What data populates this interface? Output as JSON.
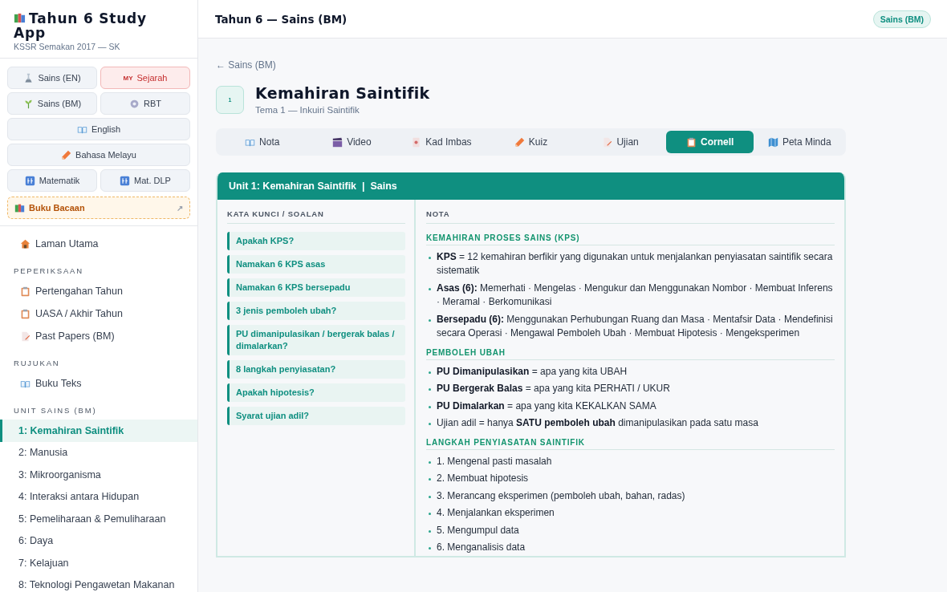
{
  "sidebar": {
    "title": "Tahun 6 Study App",
    "subtitle": "KSSR Semakan 2017 — SK",
    "subjects": [
      {
        "label": "Sains (EN)",
        "kind": "plain",
        "wide": false
      },
      {
        "label": "Sejarah",
        "kind": "featured",
        "wide": false,
        "flag": "MY"
      },
      {
        "label": "Sains (BM)",
        "kind": "plain",
        "wide": false
      },
      {
        "label": "RBT",
        "kind": "plain",
        "wide": false
      },
      {
        "label": "English",
        "kind": "plain",
        "wide": true
      },
      {
        "label": "Bahasa Melayu",
        "kind": "plain",
        "wide": true
      },
      {
        "label": "Matematik",
        "kind": "plain",
        "wide": false
      },
      {
        "label": "Mat. DLP",
        "kind": "plain",
        "wide": false
      },
      {
        "label": "Buku Bacaan",
        "kind": "reading",
        "wide": true,
        "trailing": "↗"
      }
    ],
    "home": {
      "label": "Laman Utama",
      "selected": false
    },
    "sections": [
      {
        "heading": "PEPERIKSAAN",
        "items": [
          {
            "label": "Pertengahan Tahun",
            "selected": false
          },
          {
            "label": "UASA / Akhir Tahun",
            "selected": false
          },
          {
            "label": "Past Papers (BM)",
            "selected": false
          }
        ]
      },
      {
        "heading": "RUJUKAN",
        "items": [
          {
            "label": "Buku Teks",
            "selected": false
          }
        ]
      },
      {
        "heading": "UNIT SAINS (BM)",
        "items": [
          {
            "label": "1: Kemahiran Saintifik",
            "selected": true
          },
          {
            "label": "2: Manusia",
            "selected": false
          },
          {
            "label": "3: Mikroorganisma",
            "selected": false
          },
          {
            "label": "4: Interaksi antara Hidupan",
            "selected": false
          },
          {
            "label": "5: Pemeliharaan & Pemuliharaan",
            "selected": false
          },
          {
            "label": "6: Daya",
            "selected": false
          },
          {
            "label": "7: Kelajuan",
            "selected": false
          },
          {
            "label": "8: Teknologi Pengawetan Makanan",
            "selected": false
          }
        ]
      }
    ]
  },
  "topbar": {
    "title": "Tahun 6 — Sains (BM)",
    "badge": "Sains (BM)"
  },
  "page": {
    "back": "← Sains (BM)",
    "number": "1",
    "title": "Kemahiran Saintifik",
    "subtitle": "Tema 1 — Inkuiri Saintifik",
    "tabs": [
      {
        "label": "Nota",
        "selected": false
      },
      {
        "label": "Video",
        "selected": false
      },
      {
        "label": "Kad Imbas",
        "selected": false
      },
      {
        "label": "Kuiz",
        "selected": false
      },
      {
        "label": "Ujian",
        "selected": false
      },
      {
        "label": "Cornell",
        "selected": true
      },
      {
        "label": "Peta Minda",
        "selected": false
      }
    ]
  },
  "cornell": {
    "header": "Unit 1: Kemahiran Saintifik  |  Sains",
    "cues_heading": "KATA KUNCI / SOALAN",
    "notes_heading": "NOTA",
    "cues": [
      "Apakah KPS?",
      "Namakan 6 KPS asas",
      "Namakan 6 KPS bersepadu",
      "3 jenis pemboleh ubah?",
      "PU dimanipulasikan / bergerak balas / dimalarkan?",
      "8 langkah penyiasatan?",
      "Apakah hipotesis?",
      "Syarat ujian adil?"
    ],
    "sections": [
      {
        "heading": "KEMAHIRAN PROSES SAINS (KPS)",
        "points": [
          "**KPS** = 12 kemahiran berfikir yang digunakan untuk menjalankan penyiasatan saintifik secara sistematik",
          "**Asas (6):** Memerhati · Mengelas · Mengukur dan Menggunakan Nombor · Membuat Inferens · Meramal · Berkomunikasi",
          "**Bersepadu (6):** Menggunakan Perhubungan Ruang dan Masa · Mentafsir Data · Mendefinisi secara Operasi · Mengawal Pemboleh Ubah · Membuat Hipotesis · Mengeksperimen"
        ]
      },
      {
        "heading": "PEMBOLEH UBAH",
        "points": [
          "**PU Dimanipulasikan** = apa yang kita UBAH",
          "**PU Bergerak Balas** = apa yang kita PERHATI / UKUR",
          "**PU Dimalarkan** = apa yang kita KEKALKAN SAMA",
          "Ujian adil = hanya **SATU pemboleh ubah** dimanipulasikan pada satu masa"
        ]
      },
      {
        "heading": "LANGKAH PENYIASATAN SAINTIFIK",
        "points": [
          "1. Mengenal pasti masalah",
          "2. Membuat hipotesis",
          "3. Merancang eksperimen (pemboleh ubah, bahan, radas)",
          "4. Menjalankan eksperimen",
          "5. Mengumpul data",
          "6. Menganalisis data"
        ]
      }
    ]
  }
}
